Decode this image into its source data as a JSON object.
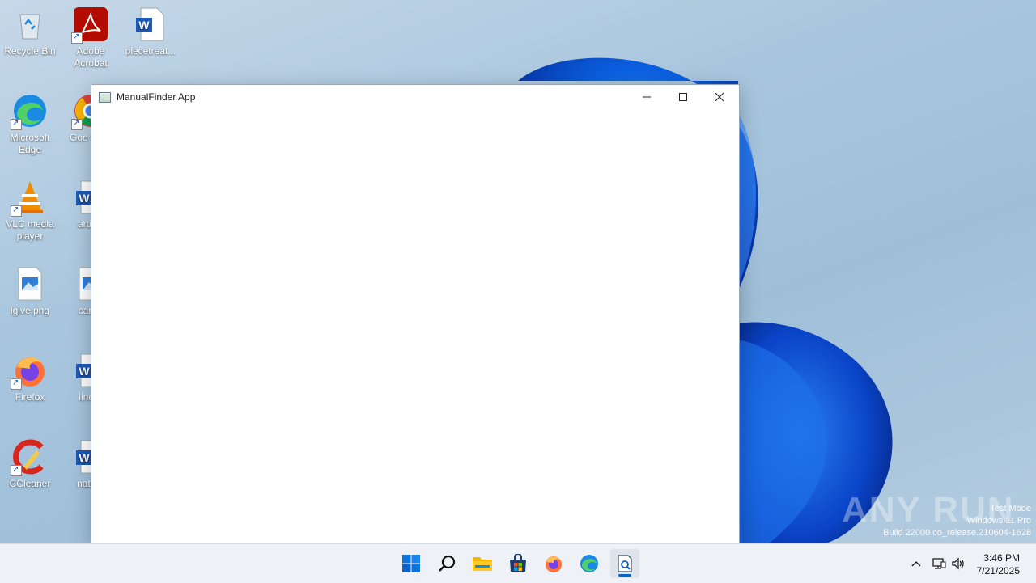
{
  "desktop": {
    "icons": [
      {
        "label": "Recycle Bin",
        "icon": "recycle-bin-icon"
      },
      {
        "label": "Adobe Acrobat",
        "icon": "adobe-acrobat-icon"
      },
      {
        "label": "piecetreat...",
        "icon": "word-document-icon"
      },
      {
        "label": "Microsoft Edge",
        "icon": "edge-icon"
      },
      {
        "label": "Goo Chro",
        "icon": "chrome-icon"
      },
      {
        "label": "VLC media player",
        "icon": "vlc-icon"
      },
      {
        "label": "artists",
        "icon": "word-document-icon"
      },
      {
        "label": "igive.png",
        "icon": "image-file-icon"
      },
      {
        "label": "cartgr",
        "icon": "image-file-icon"
      },
      {
        "label": "Firefox",
        "icon": "firefox-icon"
      },
      {
        "label": "linere",
        "icon": "word-document-icon"
      },
      {
        "label": "CCleaner",
        "icon": "ccleaner-icon"
      },
      {
        "label": "nature",
        "icon": "word-document-icon"
      }
    ]
  },
  "window": {
    "title": "ManualFinder App",
    "controls": {
      "minimize": "minimize-icon",
      "maximize": "maximize-icon",
      "close": "close-icon"
    }
  },
  "taskbar": {
    "items": [
      "start-icon",
      "search-icon",
      "file-explorer-icon",
      "microsoft-store-icon",
      "firefox-icon",
      "edge-icon",
      "manualfinder-app-icon"
    ],
    "active_item": "manualfinder-app-icon",
    "tray": [
      "chevron-up-icon",
      "network-icon",
      "volume-icon"
    ],
    "time": "3:46 PM",
    "date": "7/21/2025"
  },
  "watermark": {
    "brand": "ANY RUN",
    "line1": "Test Mode",
    "line2": "Windows 11 Pro",
    "line3": "Build 22000.co_release.210604-1628"
  },
  "colors": {
    "accent": "#0a64c8",
    "taskbar": "#eef1f5"
  }
}
